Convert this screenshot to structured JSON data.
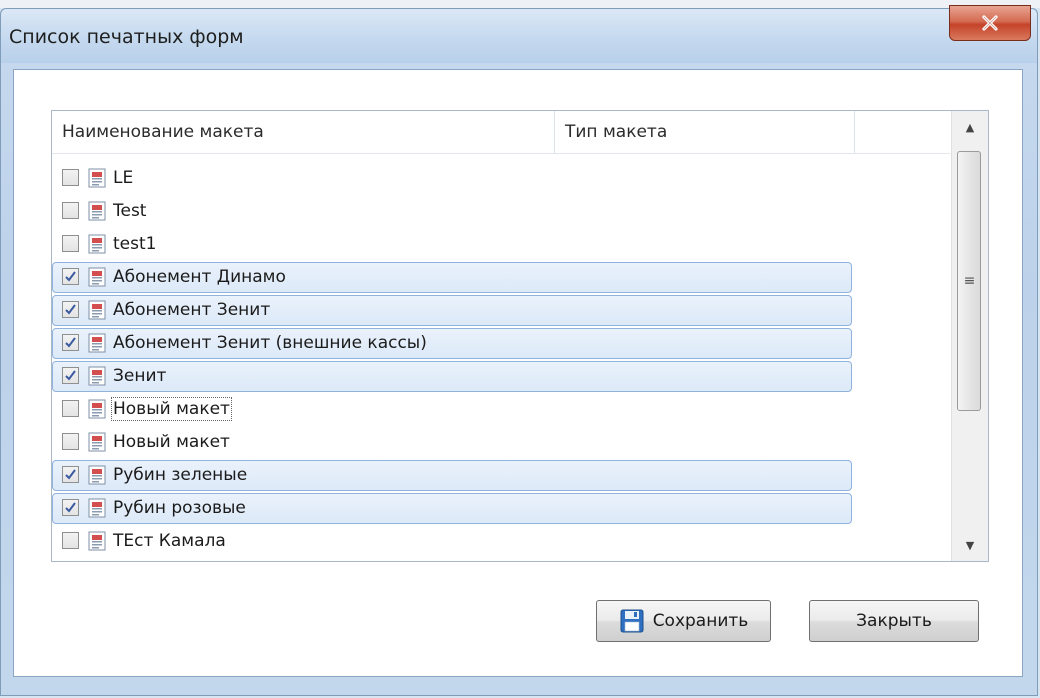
{
  "window": {
    "title": "Список печатных форм"
  },
  "grid": {
    "columns": [
      "Наименование макета",
      "Тип макета",
      ""
    ],
    "rows": [
      {
        "label": "LE",
        "checked": false,
        "selected": false
      },
      {
        "label": "Test",
        "checked": false,
        "selected": false
      },
      {
        "label": "test1",
        "checked": false,
        "selected": false
      },
      {
        "label": "Абонемент Динамо",
        "checked": true,
        "selected": true
      },
      {
        "label": "Абонемент Зенит",
        "checked": true,
        "selected": true
      },
      {
        "label": "Абонемент Зенит (внешние кассы)",
        "checked": true,
        "selected": true
      },
      {
        "label": "Зенит",
        "checked": true,
        "selected": true
      },
      {
        "label": "Новый макет",
        "checked": false,
        "selected": false
      },
      {
        "label": "Новый макет",
        "checked": false,
        "selected": false
      },
      {
        "label": "Рубин зеленые",
        "checked": true,
        "selected": true
      },
      {
        "label": "Рубин розовые",
        "checked": true,
        "selected": true
      },
      {
        "label": "ТЕст Камала",
        "checked": false,
        "selected": false
      }
    ]
  },
  "buttons": {
    "save_label": "Сохранить",
    "close_label": "Закрыть"
  },
  "icons": {
    "close": "close-icon",
    "row_icon": "document-template-icon",
    "save": "floppy-disk-icon"
  }
}
